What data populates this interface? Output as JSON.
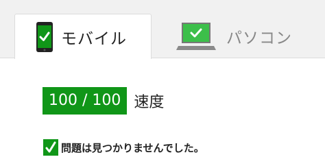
{
  "tabs": {
    "mobile": {
      "label": "モバイル",
      "icon": "phone-check-icon",
      "selected": true
    },
    "pc": {
      "label": "パソコン",
      "icon": "laptop-check-icon",
      "selected": false
    }
  },
  "score": {
    "value": "100 / 100",
    "label": "速度"
  },
  "result": {
    "icon": "checkmark-icon",
    "text": "問題は見つかりませんでした。"
  },
  "colors": {
    "good_green": "#109618",
    "tabbar_bg": "#f1f1f1",
    "inactive_text": "#888888"
  }
}
